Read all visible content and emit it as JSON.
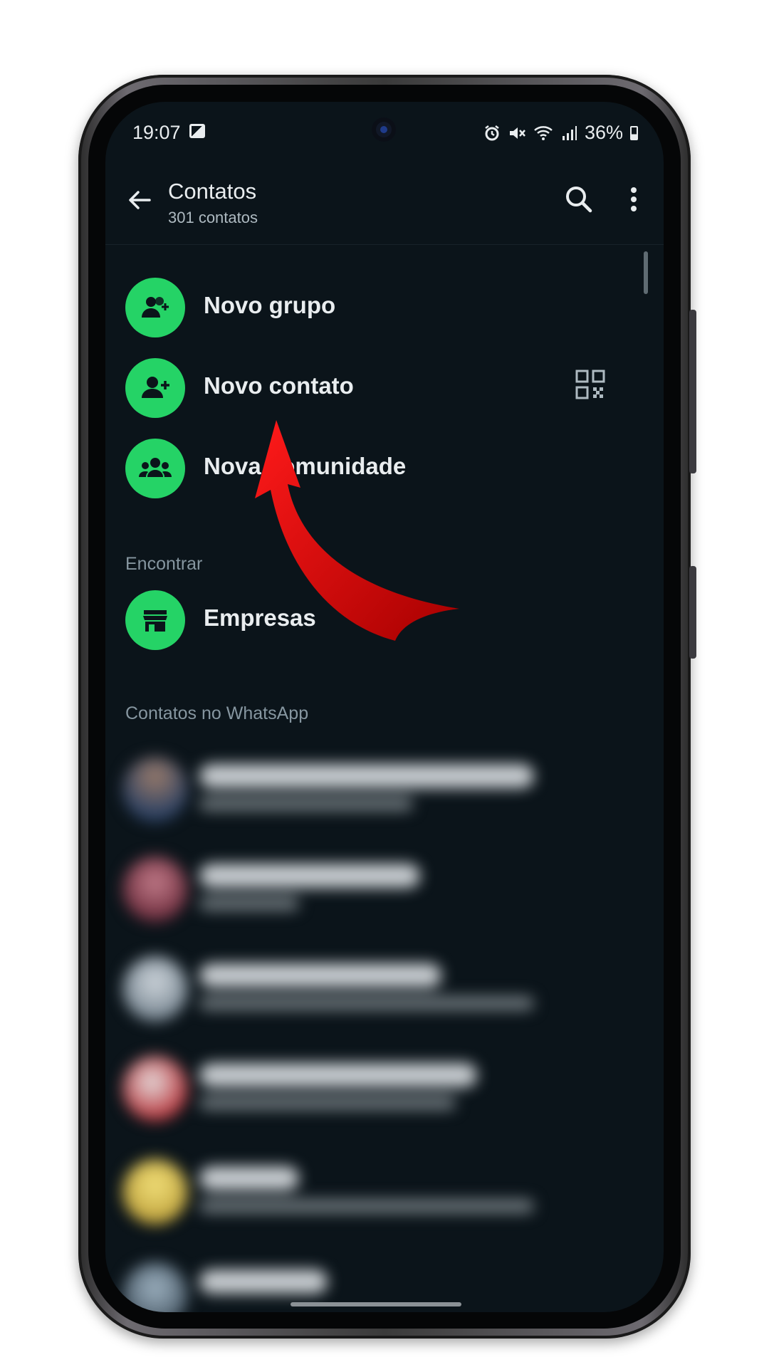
{
  "status_bar": {
    "time": "19:07",
    "battery": "36%",
    "icons": [
      "image-icon",
      "alarm-icon",
      "mute-icon",
      "wifi-icon",
      "signal-icon",
      "battery-icon"
    ]
  },
  "app_bar": {
    "title": "Contatos",
    "subtitle": "301 contatos",
    "icons": [
      "back-arrow-icon",
      "search-icon",
      "more-vert-icon"
    ]
  },
  "actions": [
    {
      "label": "Novo grupo",
      "icon": "group-add-icon"
    },
    {
      "label": "Novo contato",
      "icon": "person-add-icon",
      "trailing_icon": "qr-code-icon"
    },
    {
      "label": "Nova comunidade",
      "icon": "community-icon"
    }
  ],
  "find_section": {
    "header": "Encontrar",
    "items": [
      {
        "label": "Empresas",
        "icon": "store-icon"
      }
    ]
  },
  "contacts_section": {
    "header": "Contatos no WhatsApp"
  },
  "colors": {
    "background": "#0b141a",
    "accent_green": "#25d366",
    "annotation_arrow": "#d10000"
  },
  "annotation": "red arrow pointing to Novo contato"
}
